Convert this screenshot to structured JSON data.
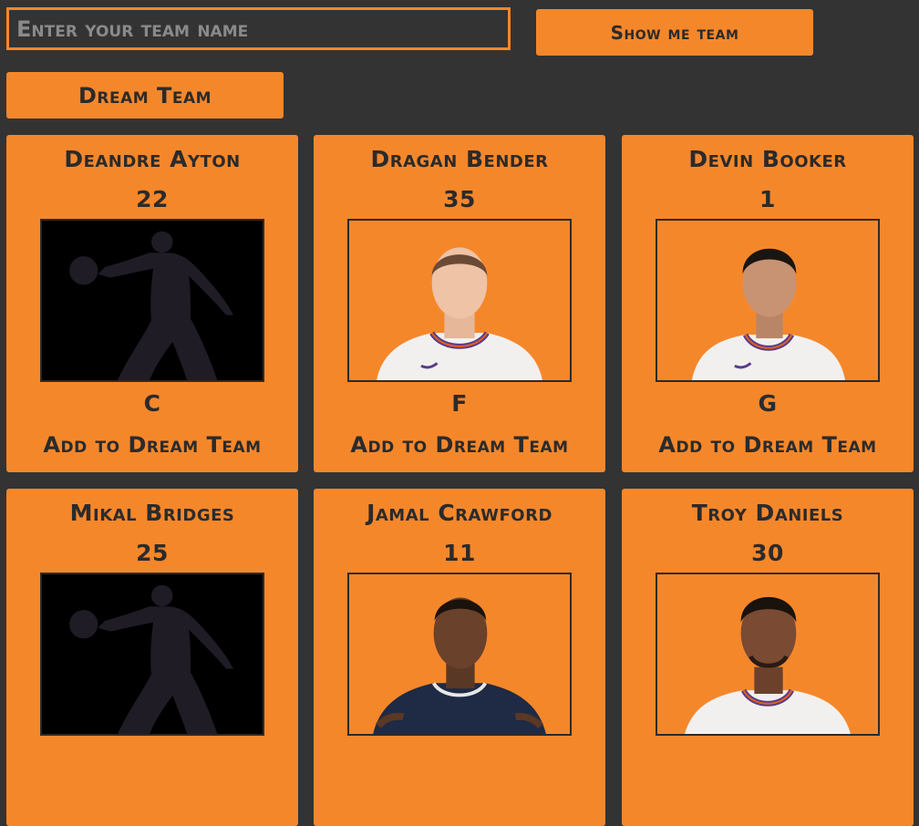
{
  "search": {
    "placeholder": "Enter your team name",
    "value": ""
  },
  "buttons": {
    "show_team": "Show me team",
    "dream_team": "Dream Team"
  },
  "players": [
    {
      "name": "Deandre Ayton",
      "number": "22",
      "position": "C",
      "add_label": "Add to Dream Team",
      "photo": "silhouette"
    },
    {
      "name": "Dragan Bender",
      "number": "35",
      "position": "F",
      "add_label": "Add to Dream Team",
      "photo": "headshot"
    },
    {
      "name": "Devin Booker",
      "number": "1",
      "position": "G",
      "add_label": "Add to Dream Team",
      "photo": "headshot"
    },
    {
      "name": "Mikal Bridges",
      "number": "25",
      "position": "",
      "add_label": "",
      "photo": "silhouette"
    },
    {
      "name": "Jamal Crawford",
      "number": "11",
      "position": "",
      "add_label": "",
      "photo": "headshot"
    },
    {
      "name": "Troy Daniels",
      "number": "30",
      "position": "",
      "add_label": "",
      "photo": "headshot"
    }
  ],
  "colors": {
    "background": "#333333",
    "accent": "#f5872b",
    "text": "#2b2b2b"
  }
}
